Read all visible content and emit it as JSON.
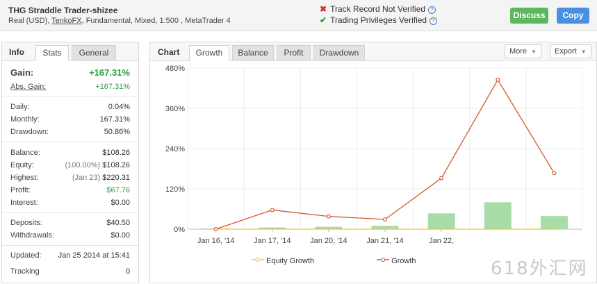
{
  "header": {
    "title": "THG Straddle Trader-shizee",
    "subtitle_prefix": "Real (USD),",
    "broker": "TenkoFX",
    "subtitle_suffix": ", Fundamental, Mixed, 1:500 , MetaTrader 4",
    "track_record": "Track Record Not Verified",
    "trading_privileges": "Trading Privileges Verified",
    "discuss_label": "Discuss",
    "copy_label": "Copy"
  },
  "left": {
    "tab_title": "Info",
    "tabs": [
      "Stats",
      "General"
    ],
    "gain": {
      "label": "Gain:",
      "value": "+167.31%"
    },
    "abs_gain": {
      "label": "Abs. Gain:",
      "value": "+167.31%"
    },
    "daily": {
      "label": "Daily:",
      "value": "0.04%"
    },
    "monthly": {
      "label": "Monthly:",
      "value": "167.31%"
    },
    "drawdown": {
      "label": "Drawdown:",
      "value": "50.86%"
    },
    "balance": {
      "label": "Balance:",
      "value": "$108.26"
    },
    "equity": {
      "label": "Equity:",
      "note": "(100.00%)",
      "value": "$108.26"
    },
    "highest": {
      "label": "Highest:",
      "note": "(Jan 23)",
      "value": "$220.31"
    },
    "profit": {
      "label": "Profit:",
      "value": "$67.76"
    },
    "interest": {
      "label": "Interest:",
      "value": "$0.00"
    },
    "deposits": {
      "label": "Deposits:",
      "value": "$40.50"
    },
    "withdrawals": {
      "label": "Withdrawals:",
      "value": "$0.00"
    },
    "updated": {
      "label": "Updated:",
      "value": "Jan 25 2014 at 15:41"
    },
    "tracking": {
      "label": "Tracking",
      "value": "0"
    }
  },
  "right": {
    "tab_title": "Chart",
    "tabs": [
      "Growth",
      "Balance",
      "Profit",
      "Drawdown"
    ],
    "more_label": "More",
    "export_label": "Export"
  },
  "watermark": "618外汇网",
  "colors": {
    "growth_line": "#d4562c",
    "equity_line": "#f0c040",
    "bars": "#a8dca8",
    "positive": "#2e9e3e"
  },
  "chart_data": {
    "type": "line",
    "y_ticks": [
      "0%",
      "120%",
      "240%",
      "360%",
      "480%"
    ],
    "ylim": [
      0,
      480
    ],
    "x_labels": [
      "Jan 16, '14",
      "Jan 17, '14",
      "Jan 20, '14",
      "Jan 21, '14",
      "Jan 22,"
    ],
    "series": [
      {
        "name": "Equity Growth",
        "values": [
          0,
          0,
          0,
          0,
          0,
          0,
          0
        ]
      },
      {
        "name": "Growth",
        "values": [
          0,
          57,
          38,
          29,
          152,
          445,
          167
        ]
      }
    ],
    "bars": [
      2,
      5,
      7,
      10,
      47,
      80,
      39
    ],
    "legend_position": "bottom"
  }
}
